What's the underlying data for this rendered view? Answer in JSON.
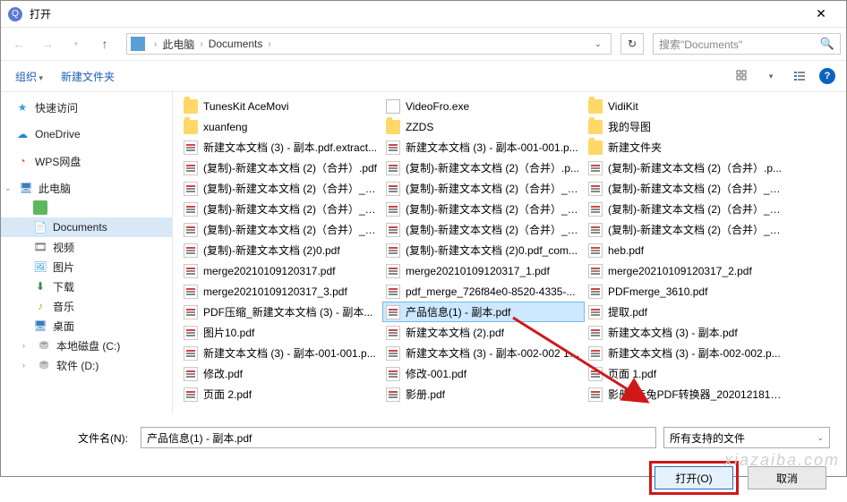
{
  "window": {
    "title": "打开"
  },
  "breadcrumbs": {
    "pc": "此电脑",
    "folder": "Documents"
  },
  "search": {
    "placeholder": "搜索\"Documents\""
  },
  "toolbar": {
    "organize": "组织",
    "newfolder": "新建文件夹"
  },
  "tree": {
    "quick": "快速访问",
    "onedrive": "OneDrive",
    "wps": "WPS网盘",
    "thispc": "此电脑",
    "documents": "Documents",
    "video": "视频",
    "pictures": "图片",
    "downloads": "下载",
    "music": "音乐",
    "desktop": "桌面",
    "diskc": "本地磁盘 (C:)",
    "diskd": "软件 (D:)"
  },
  "files": {
    "c1": [
      {
        "t": "folder",
        "n": "TunesKit AceMovi"
      },
      {
        "t": "folder",
        "n": "xuanfeng"
      },
      {
        "t": "pdf",
        "n": "新建文本文档 (3) - 副本.pdf.extract..."
      },
      {
        "t": "pdf",
        "n": "(复制)-新建文本文档 (2)（合并）.pdf"
      },
      {
        "t": "pdf",
        "n": "(复制)-新建文本文档 (2)（合并）_1..."
      },
      {
        "t": "pdf",
        "n": "(复制)-新建文本文档 (2)（合并）_加..."
      },
      {
        "t": "pdf",
        "n": "(复制)-新建文本文档 (2)（合并）_加..."
      },
      {
        "t": "pdf",
        "n": "(复制)-新建文本文档 (2)0.pdf"
      },
      {
        "t": "pdf",
        "n": "merge20210109120317.pdf"
      },
      {
        "t": "pdf",
        "n": "merge20210109120317_3.pdf"
      },
      {
        "t": "pdf",
        "n": "PDF压缩_新建文本文档 (3) - 副本..."
      },
      {
        "t": "pdf",
        "n": "图片10.pdf"
      },
      {
        "t": "pdf",
        "n": "新建文本文档 (3) - 副本-001-001.p..."
      },
      {
        "t": "pdf",
        "n": "修改.pdf"
      },
      {
        "t": "pdf",
        "n": "页面 2.pdf"
      }
    ],
    "c2": [
      {
        "t": "exe",
        "n": "VideoFro.exe"
      },
      {
        "t": "folder",
        "n": "ZZDS"
      },
      {
        "t": "pdf",
        "n": "新建文本文档 (3) - 副本-001-001.p..."
      },
      {
        "t": "pdf",
        "n": "(复制)-新建文本文档 (2)（合并）.p..."
      },
      {
        "t": "pdf",
        "n": "(复制)-新建文本文档 (2)（合并）_c..."
      },
      {
        "t": "pdf",
        "n": "(复制)-新建文本文档 (2)（合并）_加..."
      },
      {
        "t": "pdf",
        "n": "(复制)-新建文本文档 (2)（合并）_加..."
      },
      {
        "t": "pdf",
        "n": "(复制)-新建文本文档 (2)0.pdf_com..."
      },
      {
        "t": "pdf",
        "n": "merge20210109120317_1.pdf"
      },
      {
        "t": "pdf",
        "n": "pdf_merge_726f84e0-8520-4335-..."
      },
      {
        "t": "pdf",
        "n": "产品信息(1) - 副本.pdf",
        "sel": true
      },
      {
        "t": "pdf",
        "n": "新建文本文档 (2).pdf"
      },
      {
        "t": "pdf",
        "n": "新建文本文档 (3) - 副本-002-002 1...."
      },
      {
        "t": "pdf",
        "n": "修改-001.pdf"
      },
      {
        "t": "pdf",
        "n": "影册.pdf"
      }
    ],
    "c3": [
      {
        "t": "folder",
        "n": "VidiKit"
      },
      {
        "t": "folder",
        "n": "我的导图"
      },
      {
        "t": "folder",
        "n": "新建文件夹"
      },
      {
        "t": "pdf",
        "n": "(复制)-新建文本文档 (2)（合并）.p..."
      },
      {
        "t": "pdf",
        "n": "(复制)-新建文本文档 (2)（合并）_加..."
      },
      {
        "t": "pdf",
        "n": "(复制)-新建文本文档 (2)（合并）_加..."
      },
      {
        "t": "pdf",
        "n": "(复制)-新建文本文档 (2)（合并）_已..."
      },
      {
        "t": "pdf",
        "n": "heb.pdf"
      },
      {
        "t": "pdf",
        "n": "merge20210109120317_2.pdf"
      },
      {
        "t": "pdf",
        "n": "PDFmerge_3610.pdf"
      },
      {
        "t": "pdf",
        "n": "提取.pdf"
      },
      {
        "t": "pdf",
        "n": "新建文本文档 (3) - 副本.pdf"
      },
      {
        "t": "pdf",
        "n": "新建文本文档 (3) - 副本-002-002.p..."
      },
      {
        "t": "pdf",
        "n": "页面 1.pdf"
      },
      {
        "t": "pdf",
        "n": "影册_赤兔PDF转换器_20201218102..."
      }
    ]
  },
  "footer": {
    "filename_label": "文件名(N):",
    "filename_value": "产品信息(1) - 副本.pdf",
    "filter": "所有支持的文件",
    "open": "打开(O)",
    "cancel": "取消"
  },
  "watermark": "xiazaiba.com"
}
